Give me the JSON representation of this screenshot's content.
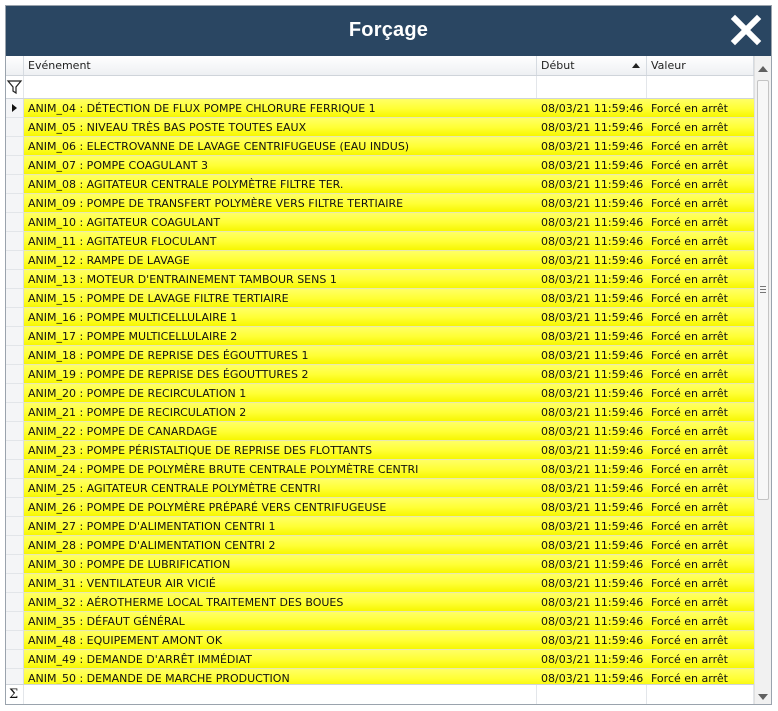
{
  "window": {
    "title": "Forçage"
  },
  "columns": {
    "event": "Evénement",
    "start": "Début",
    "value": "Valeur"
  },
  "footer": {
    "sum_symbol": "Σ"
  },
  "rows": [
    {
      "event": "ANIM_04 : DÉTECTION DE FLUX POMPE CHLORURE FERRIQUE 1",
      "start": "08/03/21 11:59:46",
      "value": "Forcé en arrêt"
    },
    {
      "event": "ANIM_05 : NIVEAU TRÈS BAS POSTE TOUTES EAUX",
      "start": "08/03/21 11:59:46",
      "value": "Forcé en arrêt"
    },
    {
      "event": "ANIM_06 : ELECTROVANNE DE LAVAGE CENTRIFUGEUSE (EAU INDUS)",
      "start": "08/03/21 11:59:46",
      "value": "Forcé en arrêt"
    },
    {
      "event": "ANIM_07 : POMPE COAGULANT 3",
      "start": "08/03/21 11:59:46",
      "value": "Forcé en arrêt"
    },
    {
      "event": "ANIM_08 : AGITATEUR CENTRALE POLYMÈTRE FILTRE TER.",
      "start": "08/03/21 11:59:46",
      "value": "Forcé en arrêt"
    },
    {
      "event": "ANIM_09 : POMPE DE TRANSFERT POLYMÈRE VERS FILTRE TERTIAIRE",
      "start": "08/03/21 11:59:46",
      "value": "Forcé en arrêt"
    },
    {
      "event": "ANIM_10 : AGITATEUR COAGULANT",
      "start": "08/03/21 11:59:46",
      "value": "Forcé en arrêt"
    },
    {
      "event": "ANIM_11 : AGITATEUR FLOCULANT",
      "start": "08/03/21 11:59:46",
      "value": "Forcé en arrêt"
    },
    {
      "event": "ANIM_12 : RAMPE DE LAVAGE",
      "start": "08/03/21 11:59:46",
      "value": "Forcé en arrêt"
    },
    {
      "event": "ANIM_13 : MOTEUR D'ENTRAINEMENT TAMBOUR SENS 1",
      "start": "08/03/21 11:59:46",
      "value": "Forcé en arrêt"
    },
    {
      "event": "ANIM_15 : POMPE DE LAVAGE FILTRE TERTIAIRE",
      "start": "08/03/21 11:59:46",
      "value": "Forcé en arrêt"
    },
    {
      "event": "ANIM_16 : POMPE MULTICELLULAIRE 1",
      "start": "08/03/21 11:59:46",
      "value": "Forcé en arrêt"
    },
    {
      "event": "ANIM_17 : POMPE MULTICELLULAIRE 2",
      "start": "08/03/21 11:59:46",
      "value": "Forcé en arrêt"
    },
    {
      "event": "ANIM_18 : POMPE DE REPRISE DES ÉGOUTTURES 1",
      "start": "08/03/21 11:59:46",
      "value": "Forcé en arrêt"
    },
    {
      "event": "ANIM_19 : POMPE DE REPRISE DES ÉGOUTTURES 2",
      "start": "08/03/21 11:59:46",
      "value": "Forcé en arrêt"
    },
    {
      "event": "ANIM_20 : POMPE DE RECIRCULATION 1",
      "start": "08/03/21 11:59:46",
      "value": "Forcé en arrêt"
    },
    {
      "event": "ANIM_21 : POMPE DE RECIRCULATION 2",
      "start": "08/03/21 11:59:46",
      "value": "Forcé en arrêt"
    },
    {
      "event": "ANIM_22 : POMPE DE CANARDAGE",
      "start": "08/03/21 11:59:46",
      "value": "Forcé en arrêt"
    },
    {
      "event": "ANIM_23 : POMPE PÉRISTALTIQUE DE REPRISE DES FLOTTANTS",
      "start": "08/03/21 11:59:46",
      "value": "Forcé en arrêt"
    },
    {
      "event": "ANIM_24 : POMPE DE POLYMÈRE BRUTE CENTRALE POLYMÈTRE CENTRI",
      "start": "08/03/21 11:59:46",
      "value": "Forcé en arrêt"
    },
    {
      "event": "ANIM_25 : AGITATEUR CENTRALE POLYMÈTRE CENTRI",
      "start": "08/03/21 11:59:46",
      "value": "Forcé en arrêt"
    },
    {
      "event": "ANIM_26 : POMPE DE POLYMÈRE PRÉPARÉ VERS CENTRIFUGEUSE",
      "start": "08/03/21 11:59:46",
      "value": "Forcé en arrêt"
    },
    {
      "event": "ANIM_27 : POMPE D'ALIMENTATION CENTRI 1",
      "start": "08/03/21 11:59:46",
      "value": "Forcé en arrêt"
    },
    {
      "event": "ANIM_28 : POMPE D'ALIMENTATION CENTRI 2",
      "start": "08/03/21 11:59:46",
      "value": "Forcé en arrêt"
    },
    {
      "event": "ANIM_30 : POMPE DE LUBRIFICATION",
      "start": "08/03/21 11:59:46",
      "value": "Forcé en arrêt"
    },
    {
      "event": "ANIM_31 : VENTILATEUR AIR VICIÉ",
      "start": "08/03/21 11:59:46",
      "value": "Forcé en arrêt"
    },
    {
      "event": "ANIM_32 : AÉROTHERME LOCAL TRAITEMENT DES BOUES",
      "start": "08/03/21 11:59:46",
      "value": "Forcé en arrêt"
    },
    {
      "event": "ANIM_35 : DÉFAUT GÉNÉRAL",
      "start": "08/03/21 11:59:46",
      "value": "Forcé en arrêt"
    },
    {
      "event": "ANIM_48 : EQUIPEMENT AMONT OK",
      "start": "08/03/21 11:59:46",
      "value": "Forcé en arrêt"
    },
    {
      "event": "ANIM_49 : DEMANDE D'ARRÊT IMMÉDIAT",
      "start": "08/03/21 11:59:46",
      "value": "Forcé en arrêt"
    },
    {
      "event": "ANIM_50 : DEMANDE DE MARCHE PRODUCTION",
      "start": "08/03/21 11:59:46",
      "value": "Forcé en arrêt"
    }
  ],
  "colors": {
    "titlebar": "#2a4662",
    "row_highlight": "#ffff33"
  }
}
